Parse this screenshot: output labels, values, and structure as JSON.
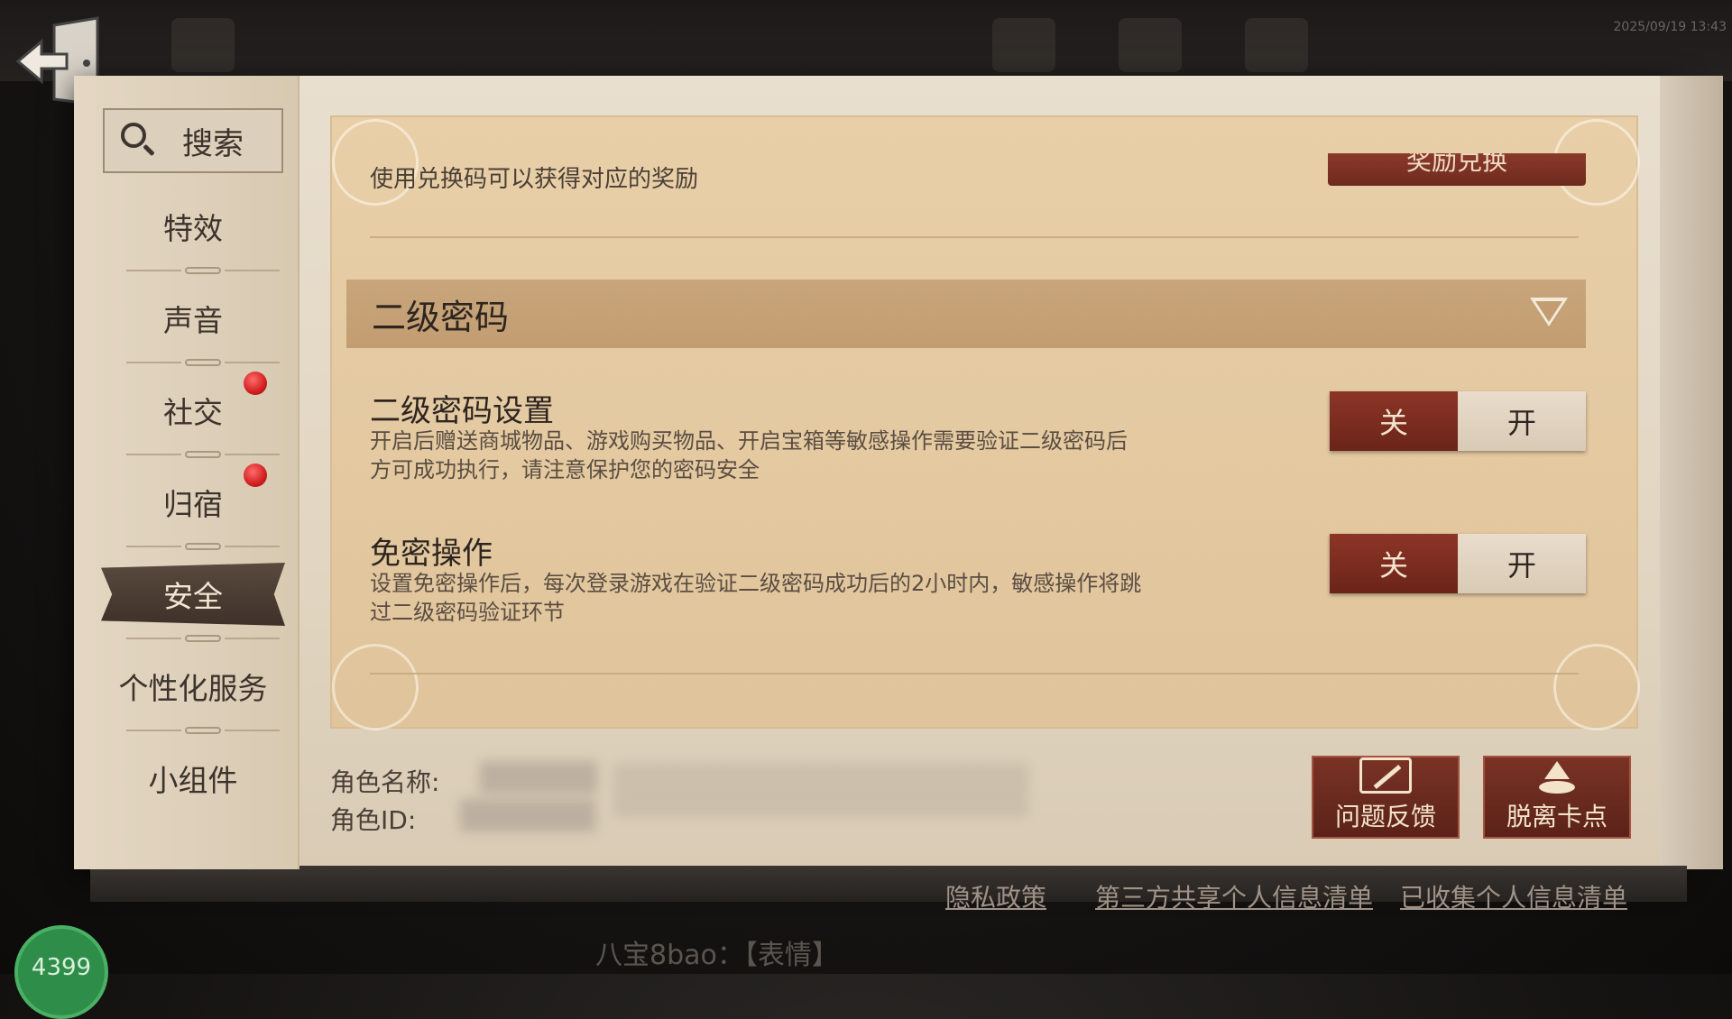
{
  "header": {
    "timestamp": "2025/09/19 13:43"
  },
  "search": {
    "label": "搜索"
  },
  "sidebar": {
    "items": [
      {
        "label": "特效",
        "badge": false
      },
      {
        "label": "声音",
        "badge": false
      },
      {
        "label": "社交",
        "badge": true
      },
      {
        "label": "归宿",
        "badge": true
      },
      {
        "label": "安全",
        "badge": false,
        "active": true
      },
      {
        "label": "个性化服务",
        "badge": false
      },
      {
        "label": "小组件",
        "badge": false
      }
    ]
  },
  "redeem": {
    "description": "使用兑换码可以获得对应的奖励",
    "button_label": "奖励兑换"
  },
  "section": {
    "title": "二级密码",
    "settings": [
      {
        "title": "二级密码设置",
        "description": "开启后赠送商城物品、游戏购买物品、开启宝箱等敏感操作需要验证二级密码后方可成功执行，请注意保护您的密码安全",
        "off_label": "关",
        "on_label": "开",
        "state": "off"
      },
      {
        "title": "免密操作",
        "description": "设置免密操作后，每次登录游戏在验证二级密码成功后的2小时内，敏感操作将跳过二级密码验证环节",
        "off_label": "关",
        "on_label": "开",
        "state": "off"
      }
    ]
  },
  "role": {
    "name_label": "角色名称:",
    "id_label": "角色ID:"
  },
  "actions": {
    "feedback_label": "问题反馈",
    "unstuck_label": "脱离卡点"
  },
  "footer": {
    "links": [
      "隐私政策",
      "第三方共享个人信息清单",
      "已收集个人信息清单"
    ]
  },
  "chat": {
    "text": "八宝8bao：【表情】"
  },
  "corner_badge": {
    "text": "4399"
  },
  "colors": {
    "accent_red": "#7a2b1f",
    "parchment": "#e2d6c2",
    "notification": "#d21f1f"
  }
}
